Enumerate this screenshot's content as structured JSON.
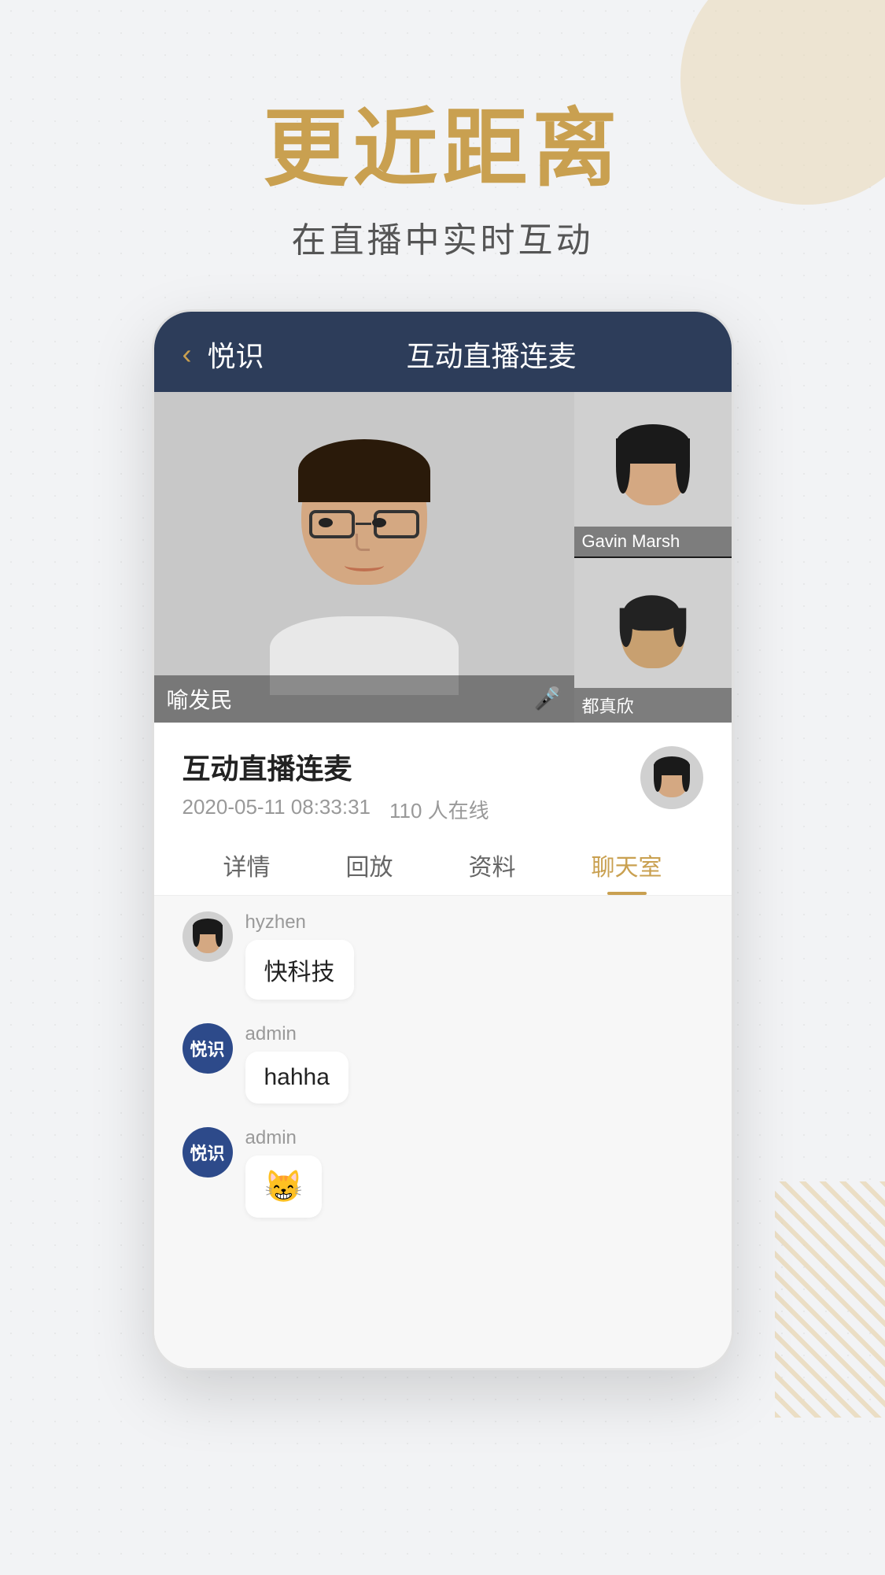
{
  "background": {
    "color": "#f2f3f5"
  },
  "hero": {
    "title": "更近距离",
    "subtitle": "在直播中实时互动"
  },
  "app": {
    "back_label": "‹",
    "name": "悦识",
    "live_title": "互动直播连麦"
  },
  "video_grid": {
    "main_user": {
      "name": "喻发民"
    },
    "side_users": [
      {
        "name": "Gavin Marsh"
      },
      {
        "name": "都真欣"
      }
    ]
  },
  "stream_info": {
    "title": "互动直播连麦",
    "date": "2020-05-11 08:33:31",
    "online": "110 人在线"
  },
  "tabs": [
    {
      "label": "详情",
      "active": false
    },
    {
      "label": "回放",
      "active": false
    },
    {
      "label": "资料",
      "active": false
    },
    {
      "label": "聊天室",
      "active": true
    }
  ],
  "chat": {
    "messages": [
      {
        "id": 1,
        "username": "hyzhen",
        "avatar_type": "image",
        "text": "快科技"
      },
      {
        "id": 2,
        "username": "admin",
        "avatar_type": "badge",
        "badge_text": "悦识",
        "text": "hahha"
      },
      {
        "id": 3,
        "username": "admin",
        "avatar_type": "badge",
        "badge_text": "悦识",
        "text": "🐱"
      }
    ]
  }
}
